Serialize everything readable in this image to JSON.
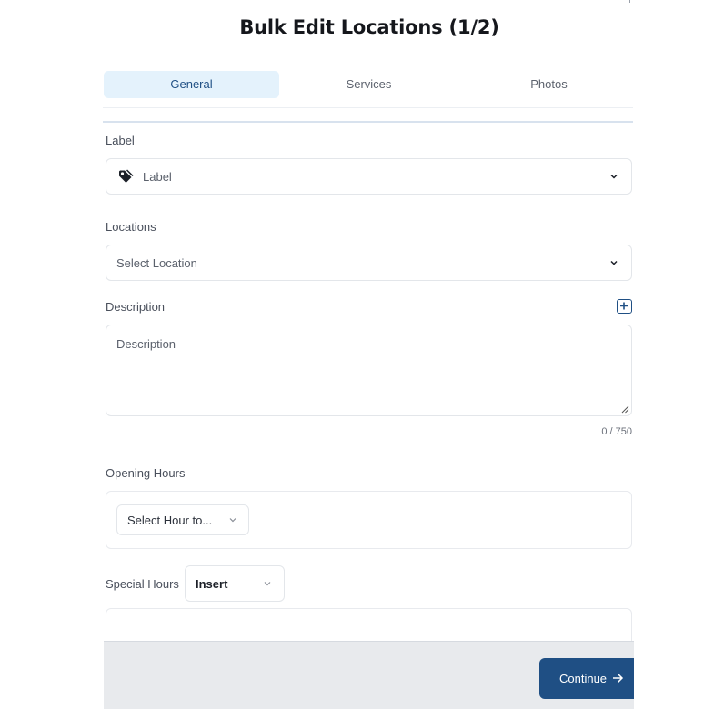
{
  "modal": {
    "title": "Bulk Edit Locations (1/2)"
  },
  "tabs": [
    {
      "label": "General",
      "active": true
    },
    {
      "label": "Services",
      "active": false
    },
    {
      "label": "Photos",
      "active": false
    }
  ],
  "label_field": {
    "label": "Label",
    "value": "Label",
    "icon": "tag-icon"
  },
  "locations_field": {
    "label": "Locations",
    "placeholder": "Select Location"
  },
  "description_field": {
    "label": "Description",
    "placeholder": "Description",
    "counter": "0 / 750",
    "add_icon": "plus-square-icon"
  },
  "opening_hours": {
    "label": "Opening Hours",
    "select_value": "Select Hour to..."
  },
  "special_hours": {
    "label": "Special Hours",
    "select_value": "Insert"
  },
  "footer": {
    "continue_label": "Continue",
    "continue_icon": "arrow-right-icon"
  },
  "colors": {
    "accent": "#1f4f84",
    "tab_active_bg": "#e4f2fc",
    "footer_bg": "#e8eaed"
  }
}
